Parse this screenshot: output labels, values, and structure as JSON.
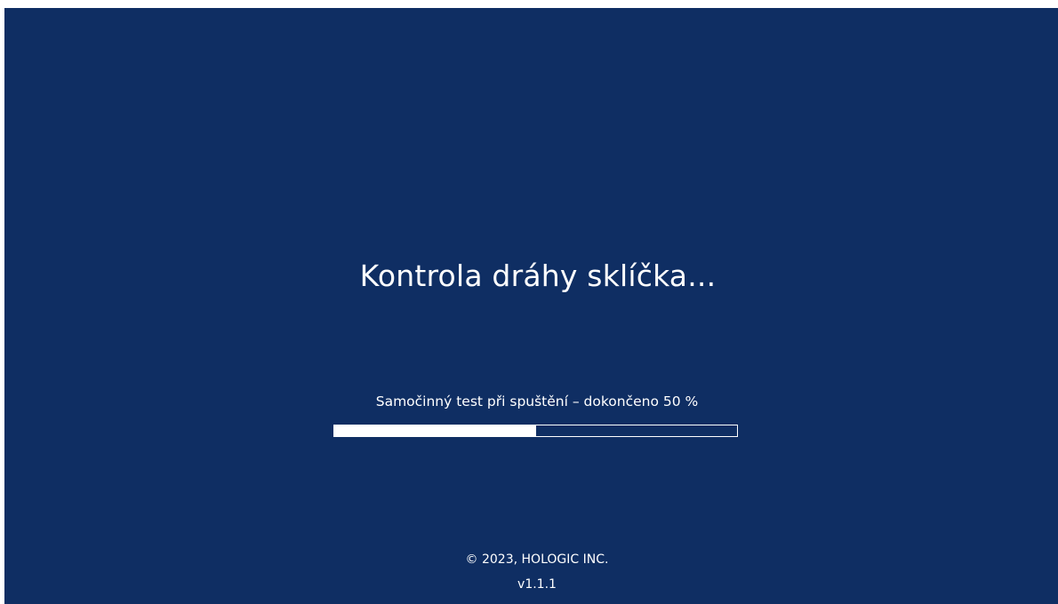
{
  "screen": {
    "title": "Kontrola dráhy sklíčka...",
    "status_text": "Samočinný test při spuštění – dokončeno 50 %",
    "progress_fraction": 0.5,
    "copyright": "© 2023, HOLOGIC INC.",
    "version": "v1.1.1"
  },
  "colors": {
    "background": "#0f2e63",
    "foreground": "#ffffff"
  }
}
